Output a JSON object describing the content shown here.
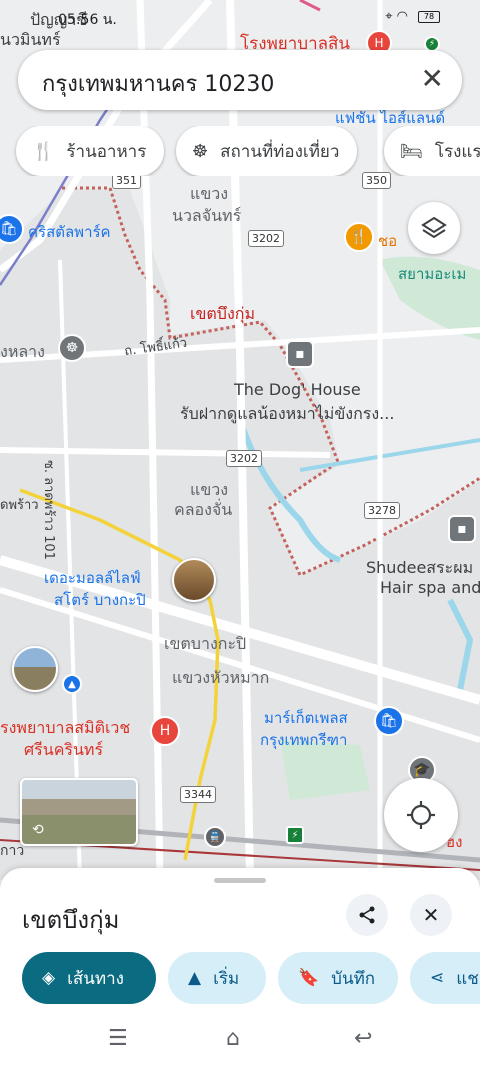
{
  "status_bar": {
    "time": "05:56 น.",
    "battery": "78"
  },
  "search": {
    "query": "กรุงเทพมหานคร 10230",
    "clear_label": "✕"
  },
  "chips": [
    {
      "label": "ร้านอาหาร",
      "icon": "fork-knife-icon"
    },
    {
      "label": "สถานที่ท่องเที่ยว",
      "icon": "ferris-wheel-icon"
    },
    {
      "label": "โรงแรม",
      "icon": "bed-icon"
    }
  ],
  "map": {
    "labels": {
      "top_left_1": "ปัญญาชี",
      "top_left_2": "นวมินทร์",
      "hospital_top": "โรงพยาบาลสิน",
      "fashion_island": "แฟชั่น ไอส์แลนด์",
      "khwaeng1": "แขวง",
      "nuanchan": "นวลจันทร์",
      "crystal_park": "คริสตัลพาร์ค",
      "district_bueng_kum": "เขตบึงกุ่ม",
      "nonglang": "งหลาง",
      "road_phosikaeo": "ถ. โพธิ์แก้ว",
      "dog_house_title": "The Dog' House",
      "dog_house_sub": "รับฝากดูแลน้องหมาไม่ขังกรง...",
      "lat_phrao_101": "ซ. ลาดพร้าว 101",
      "khwaeng2": "แขวง",
      "khlong_chan": "คลองจั่น",
      "ladphrao": "ดพร้าว",
      "mall_1": "เดอะมอลล์ไลฟ์",
      "mall_2": "สโตร์ บางกะปิ",
      "district_bangkapi": "เขตบางกะปิ",
      "hua_mak": "แขวงหัวหมาก",
      "shudee_1": "Shudeeสระผม",
      "shudee_2": "Hair spa and",
      "hospital_1": "รงพยาบาลสมิติเวช",
      "hospital_2": "ศรีนครินทร์",
      "market_1": "มาร์เก็ตเพลส",
      "market_2": "กรุงเทพกรีฑา",
      "siam_amazing": "สยามอะเม",
      "chocolate": "ชอ",
      "bottom_left": "กาว",
      "bottom_right": "ฮง"
    },
    "routes": [
      "351",
      "350",
      "3202",
      "3202",
      "3278",
      "3344"
    ]
  },
  "sheet": {
    "title": "เขตบึงกุ่ม",
    "actions": [
      {
        "label": "เส้นทาง",
        "icon": "directions-icon"
      },
      {
        "label": "เริ่ม",
        "icon": "navigation-arrow-icon"
      },
      {
        "label": "บันทึก",
        "icon": "bookmark-icon"
      },
      {
        "label": "แช",
        "icon": "share-icon"
      }
    ]
  }
}
